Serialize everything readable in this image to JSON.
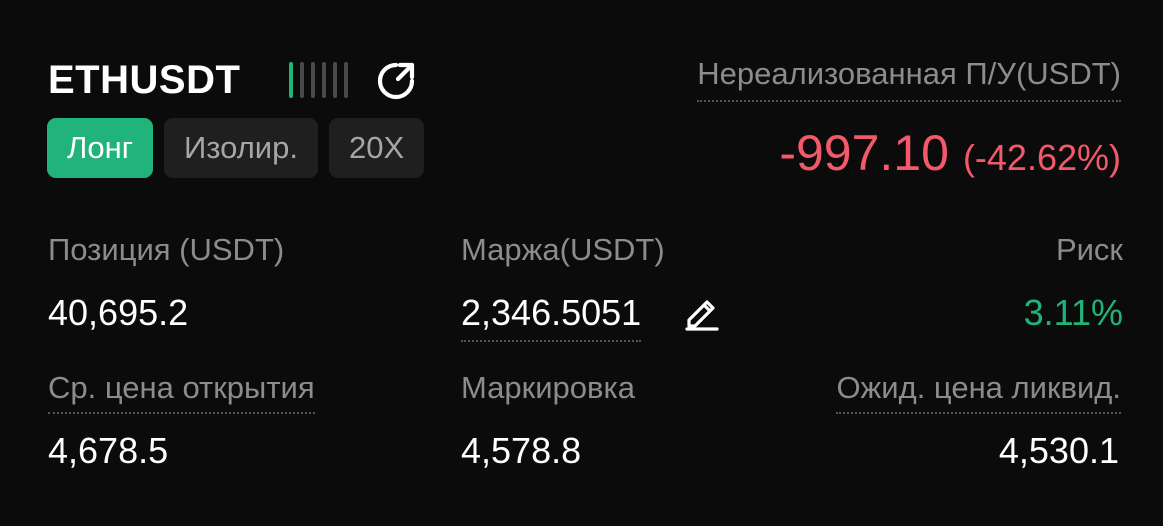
{
  "header": {
    "symbol": "ETHUSDT",
    "signal_level": {
      "active": 1,
      "total": 6
    },
    "share_icon": "refresh-share-icon"
  },
  "tags": {
    "side": "Лонг",
    "margin_mode": "Изолир.",
    "leverage": "20X"
  },
  "pnl": {
    "label": "Нереализованная П/У(USDT)",
    "amount": "-997.10",
    "percent": "(-42.62%)"
  },
  "stats": {
    "position_label": "Позиция (USDT)",
    "position_value": "40,695.2",
    "margin_label": "Маржа(USDT)",
    "margin_value": "2,346.5051",
    "risk_label": "Риск",
    "risk_value": "3.11%",
    "entry_label": "Ср. цена открытия",
    "entry_value": "4,678.5",
    "mark_label": "Маркировка",
    "mark_value": "4,578.8",
    "liq_label": "Ожид. цена ликвид.",
    "liq_value": "4,530.1"
  },
  "colors": {
    "accent_green": "#21b47a",
    "loss_red": "#f25a6b",
    "muted_text": "#8c8c8c",
    "background": "#0b0b0b"
  }
}
